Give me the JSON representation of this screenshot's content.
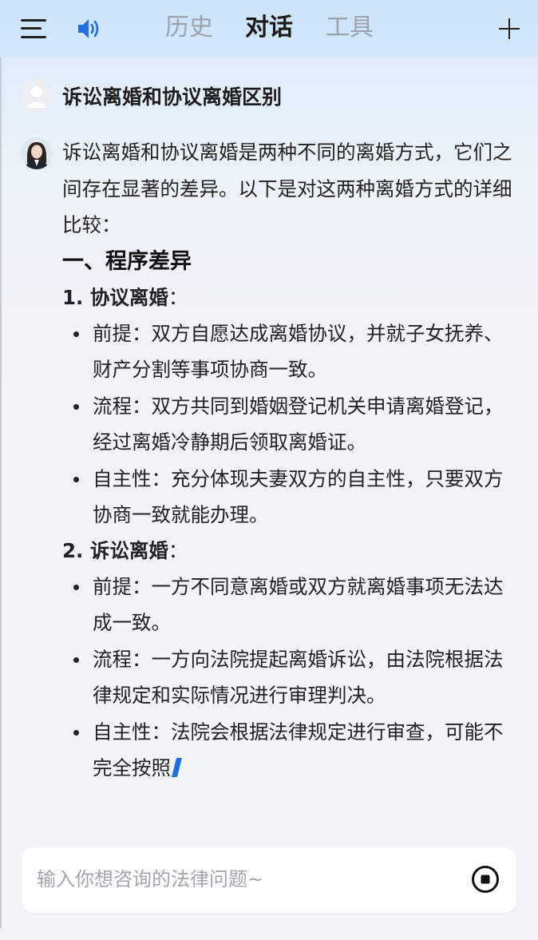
{
  "header": {
    "tabs": [
      {
        "label": "历史",
        "active": false
      },
      {
        "label": "对话",
        "active": true
      },
      {
        "label": "工具",
        "active": false
      }
    ]
  },
  "conversation": {
    "user_question": "诉讼离婚和协议离婚区别",
    "answer": {
      "intro": "诉讼离婚和协议离婚是两种不同的离婚方式，它们之间存在显著的差异。以下是对这两种离婚方式的详细比较：",
      "section_title": "一、程序差异",
      "items": [
        {
          "number": "1.",
          "title": "协议离婚",
          "suffix": "：",
          "bullets": [
            "前提：双方自愿达成离婚协议，并就子女抚养、财产分割等事项协商一致。",
            "流程：双方共同到婚姻登记机关申请离婚登记，经过离婚冷静期后领取离婚证。",
            "自主性：充分体现夫妻双方的自主性，只要双方协商一致就能办理。"
          ]
        },
        {
          "number": "2.",
          "title": "诉讼离婚",
          "suffix": "：",
          "bullets": [
            "前提：一方不同意离婚或双方就离婚事项无法达成一致。",
            "流程：一方向法院提起离婚诉讼，由法院根据法律规定和实际情况进行审理判决。",
            "自主性：法院会根据法律规定进行审查，可能不完全按照"
          ]
        }
      ]
    }
  },
  "input": {
    "placeholder": "输入你想咨询的法律问题~"
  },
  "colors": {
    "accent": "#1f6fe0",
    "inactive_tab": "#9aa3ad"
  }
}
